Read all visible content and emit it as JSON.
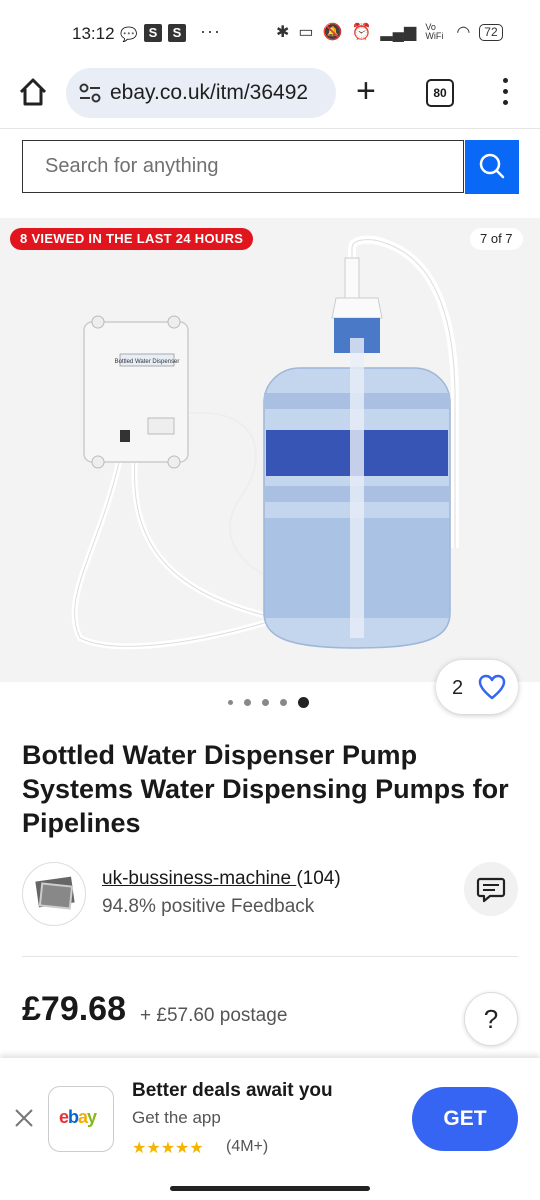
{
  "status_bar": {
    "time": "13:12",
    "app_badges": [
      "S",
      "S"
    ],
    "more": "···",
    "battery": "72",
    "wifi_label": "Vo WiFi"
  },
  "browser": {
    "url": "ebay.co.uk/itm/36492",
    "tabs_count": "80"
  },
  "search": {
    "placeholder": "Search for anything"
  },
  "gallery": {
    "viewed_badge": "8 VIEWED IN THE LAST 24 HOURS",
    "counter": "7 of 7",
    "dot_count": 5,
    "active_dot": 5,
    "image_alt": "Bottled Water Dispenser pump with water bottle",
    "pump_label": "Bottled Water Dispenser"
  },
  "watchers": {
    "count": "2"
  },
  "product": {
    "title": "Bottled Water Dispenser Pump Systems Water Dispensing Pumps for Pipelines"
  },
  "seller": {
    "name": "uk-bussiness-machine",
    "rating_count": "(104)",
    "feedback": "94.8% positive Feedback"
  },
  "pricing": {
    "price": "£79.68",
    "postage": "+ £57.60 postage",
    "help": "?"
  },
  "app_banner": {
    "title": "Better deals await you",
    "subtitle": "Get the app",
    "stars": "★★★★★",
    "rating": "(4M+)",
    "button": "GET",
    "logo_letters": [
      "e",
      "b",
      "a",
      "y"
    ],
    "logo_colors": [
      "#e53238",
      "#0064d2",
      "#f5af02",
      "#86b817"
    ]
  },
  "colors": {
    "accent_blue": "#0968f6",
    "badge_red": "#e0151d",
    "get_blue": "#3665f3"
  }
}
